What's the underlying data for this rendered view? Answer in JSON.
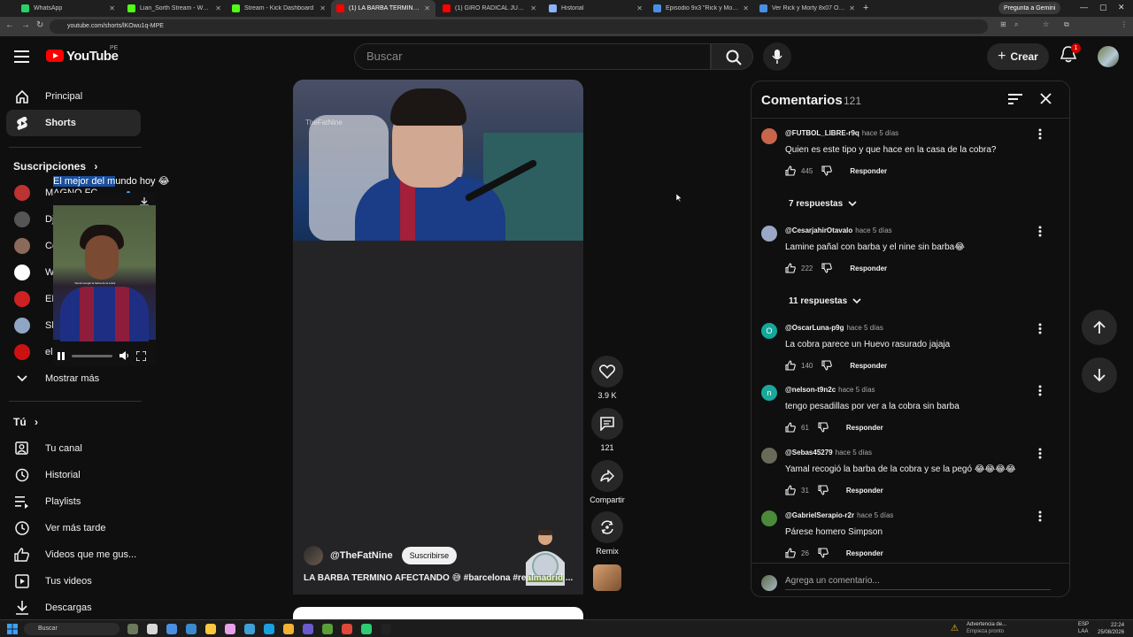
{
  "browser": {
    "tabs": [
      {
        "label": "WhatsApp",
        "color": "#25d366",
        "active": false
      },
      {
        "label": "Lian_Sorth Stream - Watch Live",
        "color": "#53fc18",
        "active": false
      },
      {
        "label": "Stream - Kick Dashboard",
        "color": "#53fc18",
        "active": false
      },
      {
        "label": "(1) LA BARBA TERMINO AFEC...",
        "color": "#ff0000",
        "active": true
      },
      {
        "label": "(1) GIRO RADICAL JULIÁN...",
        "color": "#ff0000",
        "active": false
      },
      {
        "label": "Historial",
        "color": "#8ab4f8",
        "active": false
      },
      {
        "label": "Episodio 9x3 \"Rick y Morty\"",
        "color": "#4a90e2",
        "active": false
      },
      {
        "label": "Ver Rick y Morty 8x07 Online H...",
        "color": "#4a90e2",
        "active": false
      }
    ],
    "gemini_label": "Pregunta a Gemini",
    "url": "youtube.com/shorts/lKOwu1q-MPE"
  },
  "header": {
    "logo_text": "YouTube",
    "country": "PE",
    "search_placeholder": "Buscar",
    "create_label": "Crear",
    "notif_count": "1"
  },
  "sidebar": {
    "main_items": [
      {
        "label": "Principal",
        "icon": "home-icon"
      },
      {
        "label": "Shorts",
        "icon": "shorts-icon"
      }
    ],
    "subs_heading": "Suscripciones",
    "subscriptions": [
      {
        "label": "MAGNO FC",
        "color": "#b33"
      },
      {
        "label": "DjRecuerdos",
        "color": "#555"
      },
      {
        "label": "César André",
        "color": "#8a6a5a"
      },
      {
        "label": "WATOP",
        "color": "#fff"
      },
      {
        "label": "ENMINUTOS",
        "color": "#c22"
      },
      {
        "label": "Slava Semeshko",
        "color": "#8fa5c4"
      },
      {
        "label": "elxokasTV",
        "color": "#c11"
      }
    ],
    "show_more": "Mostrar más",
    "you_heading": "Tú",
    "you_items": [
      {
        "label": "Tu canal",
        "icon": "channel-icon"
      },
      {
        "label": "Historial",
        "icon": "history-icon"
      },
      {
        "label": "Playlists",
        "icon": "playlist-icon"
      },
      {
        "label": "Ver más tarde",
        "icon": "clock-icon"
      },
      {
        "label": "Videos que me gus...",
        "icon": "thumb-up-icon"
      },
      {
        "label": "Tus videos",
        "icon": "video-icon"
      },
      {
        "label": "Descargas",
        "icon": "download-icon"
      }
    ]
  },
  "video": {
    "watermark": "TheFatNine",
    "caption_highlight": "El mejor del m",
    "caption_rest": "undo hoy 😂",
    "clip_overlay_text": "Yamal recogió la barba de la cobra",
    "channel_handle": "@TheFatNine",
    "subscribe_label": "Suscribirse",
    "title": "LA BARBA TERMINO AFECTANDO 😅 #barcelona #realmadrid ..."
  },
  "actions": {
    "likes": "3.9 K",
    "comments": "121",
    "share": "Compartir",
    "remix": "Remix"
  },
  "comments": {
    "title": "Comentarios",
    "count": "121",
    "reply_label": "Responder",
    "input_placeholder": "Agrega un comentario...",
    "items": [
      {
        "user": "@FUTBOL_LIBRE-r9q",
        "ago": "hace 5 días",
        "text": "Quien es este tipo y que hace en la casa de la cobra?",
        "likes": "445",
        "replies": "7 respuestas",
        "avatar_color": "#c8654a",
        "initial": ""
      },
      {
        "user": "@CesarjahirOtavalo",
        "ago": "hace 5 días",
        "text": "Lamine pañal con barba y el nine sin barba😂",
        "likes": "222",
        "replies": "11 respuestas",
        "avatar_color": "#9aa7c6",
        "initial": ""
      },
      {
        "user": "@OscarLuna-p9g",
        "ago": "hace 5 días",
        "text": "La cobra parece un Huevo rasurado jajaja",
        "likes": "140",
        "replies": "",
        "avatar_color": "#12a89a",
        "initial": "O"
      },
      {
        "user": "@nelson-t9n2c",
        "ago": "hace 5 días",
        "text": "tengo pesadillas por ver a la cobra sin barba",
        "likes": "61",
        "replies": "",
        "avatar_color": "#1aa89a",
        "initial": "n"
      },
      {
        "user": "@Sebas45279",
        "ago": "hace 5 días",
        "text": "Yamal recogió la barba de la cobra y se la pegó 😂😂😂😂",
        "likes": "31",
        "replies": "",
        "avatar_color": "#6a6a5a",
        "initial": ""
      },
      {
        "user": "@GabrielSerapio-r2r",
        "ago": "hace 5 días",
        "text": "Párese homero Simpson",
        "likes": "26",
        "replies": "",
        "avatar_color": "#4a8a3a",
        "initial": ""
      }
    ]
  },
  "taskbar": {
    "search_label": "Buscar",
    "tray_title": "Advertencia de...",
    "tray_sub": "Empieza pronto",
    "lang": "ESP",
    "lang2": "LAA",
    "time": "22:24",
    "date": "25/08/2026"
  }
}
